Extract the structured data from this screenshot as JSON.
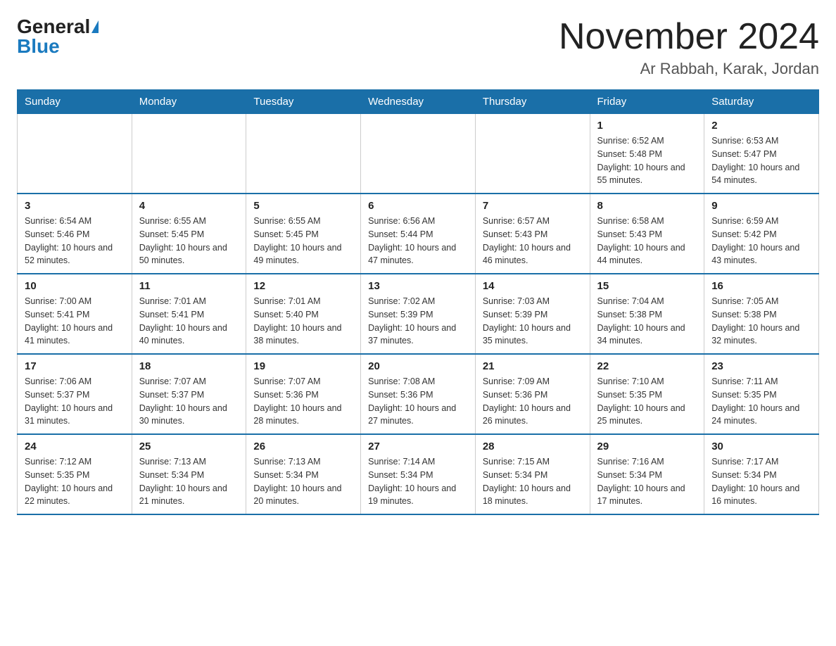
{
  "header": {
    "logo_general": "General",
    "logo_blue": "Blue",
    "month_title": "November 2024",
    "location": "Ar Rabbah, Karak, Jordan"
  },
  "weekdays": [
    "Sunday",
    "Monday",
    "Tuesday",
    "Wednesday",
    "Thursday",
    "Friday",
    "Saturday"
  ],
  "weeks": [
    [
      {
        "day": "",
        "sunrise": "",
        "sunset": "",
        "daylight": ""
      },
      {
        "day": "",
        "sunrise": "",
        "sunset": "",
        "daylight": ""
      },
      {
        "day": "",
        "sunrise": "",
        "sunset": "",
        "daylight": ""
      },
      {
        "day": "",
        "sunrise": "",
        "sunset": "",
        "daylight": ""
      },
      {
        "day": "",
        "sunrise": "",
        "sunset": "",
        "daylight": ""
      },
      {
        "day": "1",
        "sunrise": "Sunrise: 6:52 AM",
        "sunset": "Sunset: 5:48 PM",
        "daylight": "Daylight: 10 hours and 55 minutes."
      },
      {
        "day": "2",
        "sunrise": "Sunrise: 6:53 AM",
        "sunset": "Sunset: 5:47 PM",
        "daylight": "Daylight: 10 hours and 54 minutes."
      }
    ],
    [
      {
        "day": "3",
        "sunrise": "Sunrise: 6:54 AM",
        "sunset": "Sunset: 5:46 PM",
        "daylight": "Daylight: 10 hours and 52 minutes."
      },
      {
        "day": "4",
        "sunrise": "Sunrise: 6:55 AM",
        "sunset": "Sunset: 5:45 PM",
        "daylight": "Daylight: 10 hours and 50 minutes."
      },
      {
        "day": "5",
        "sunrise": "Sunrise: 6:55 AM",
        "sunset": "Sunset: 5:45 PM",
        "daylight": "Daylight: 10 hours and 49 minutes."
      },
      {
        "day": "6",
        "sunrise": "Sunrise: 6:56 AM",
        "sunset": "Sunset: 5:44 PM",
        "daylight": "Daylight: 10 hours and 47 minutes."
      },
      {
        "day": "7",
        "sunrise": "Sunrise: 6:57 AM",
        "sunset": "Sunset: 5:43 PM",
        "daylight": "Daylight: 10 hours and 46 minutes."
      },
      {
        "day": "8",
        "sunrise": "Sunrise: 6:58 AM",
        "sunset": "Sunset: 5:43 PM",
        "daylight": "Daylight: 10 hours and 44 minutes."
      },
      {
        "day": "9",
        "sunrise": "Sunrise: 6:59 AM",
        "sunset": "Sunset: 5:42 PM",
        "daylight": "Daylight: 10 hours and 43 minutes."
      }
    ],
    [
      {
        "day": "10",
        "sunrise": "Sunrise: 7:00 AM",
        "sunset": "Sunset: 5:41 PM",
        "daylight": "Daylight: 10 hours and 41 minutes."
      },
      {
        "day": "11",
        "sunrise": "Sunrise: 7:01 AM",
        "sunset": "Sunset: 5:41 PM",
        "daylight": "Daylight: 10 hours and 40 minutes."
      },
      {
        "day": "12",
        "sunrise": "Sunrise: 7:01 AM",
        "sunset": "Sunset: 5:40 PM",
        "daylight": "Daylight: 10 hours and 38 minutes."
      },
      {
        "day": "13",
        "sunrise": "Sunrise: 7:02 AM",
        "sunset": "Sunset: 5:39 PM",
        "daylight": "Daylight: 10 hours and 37 minutes."
      },
      {
        "day": "14",
        "sunrise": "Sunrise: 7:03 AM",
        "sunset": "Sunset: 5:39 PM",
        "daylight": "Daylight: 10 hours and 35 minutes."
      },
      {
        "day": "15",
        "sunrise": "Sunrise: 7:04 AM",
        "sunset": "Sunset: 5:38 PM",
        "daylight": "Daylight: 10 hours and 34 minutes."
      },
      {
        "day": "16",
        "sunrise": "Sunrise: 7:05 AM",
        "sunset": "Sunset: 5:38 PM",
        "daylight": "Daylight: 10 hours and 32 minutes."
      }
    ],
    [
      {
        "day": "17",
        "sunrise": "Sunrise: 7:06 AM",
        "sunset": "Sunset: 5:37 PM",
        "daylight": "Daylight: 10 hours and 31 minutes."
      },
      {
        "day": "18",
        "sunrise": "Sunrise: 7:07 AM",
        "sunset": "Sunset: 5:37 PM",
        "daylight": "Daylight: 10 hours and 30 minutes."
      },
      {
        "day": "19",
        "sunrise": "Sunrise: 7:07 AM",
        "sunset": "Sunset: 5:36 PM",
        "daylight": "Daylight: 10 hours and 28 minutes."
      },
      {
        "day": "20",
        "sunrise": "Sunrise: 7:08 AM",
        "sunset": "Sunset: 5:36 PM",
        "daylight": "Daylight: 10 hours and 27 minutes."
      },
      {
        "day": "21",
        "sunrise": "Sunrise: 7:09 AM",
        "sunset": "Sunset: 5:36 PM",
        "daylight": "Daylight: 10 hours and 26 minutes."
      },
      {
        "day": "22",
        "sunrise": "Sunrise: 7:10 AM",
        "sunset": "Sunset: 5:35 PM",
        "daylight": "Daylight: 10 hours and 25 minutes."
      },
      {
        "day": "23",
        "sunrise": "Sunrise: 7:11 AM",
        "sunset": "Sunset: 5:35 PM",
        "daylight": "Daylight: 10 hours and 24 minutes."
      }
    ],
    [
      {
        "day": "24",
        "sunrise": "Sunrise: 7:12 AM",
        "sunset": "Sunset: 5:35 PM",
        "daylight": "Daylight: 10 hours and 22 minutes."
      },
      {
        "day": "25",
        "sunrise": "Sunrise: 7:13 AM",
        "sunset": "Sunset: 5:34 PM",
        "daylight": "Daylight: 10 hours and 21 minutes."
      },
      {
        "day": "26",
        "sunrise": "Sunrise: 7:13 AM",
        "sunset": "Sunset: 5:34 PM",
        "daylight": "Daylight: 10 hours and 20 minutes."
      },
      {
        "day": "27",
        "sunrise": "Sunrise: 7:14 AM",
        "sunset": "Sunset: 5:34 PM",
        "daylight": "Daylight: 10 hours and 19 minutes."
      },
      {
        "day": "28",
        "sunrise": "Sunrise: 7:15 AM",
        "sunset": "Sunset: 5:34 PM",
        "daylight": "Daylight: 10 hours and 18 minutes."
      },
      {
        "day": "29",
        "sunrise": "Sunrise: 7:16 AM",
        "sunset": "Sunset: 5:34 PM",
        "daylight": "Daylight: 10 hours and 17 minutes."
      },
      {
        "day": "30",
        "sunrise": "Sunrise: 7:17 AM",
        "sunset": "Sunset: 5:34 PM",
        "daylight": "Daylight: 10 hours and 16 minutes."
      }
    ]
  ]
}
